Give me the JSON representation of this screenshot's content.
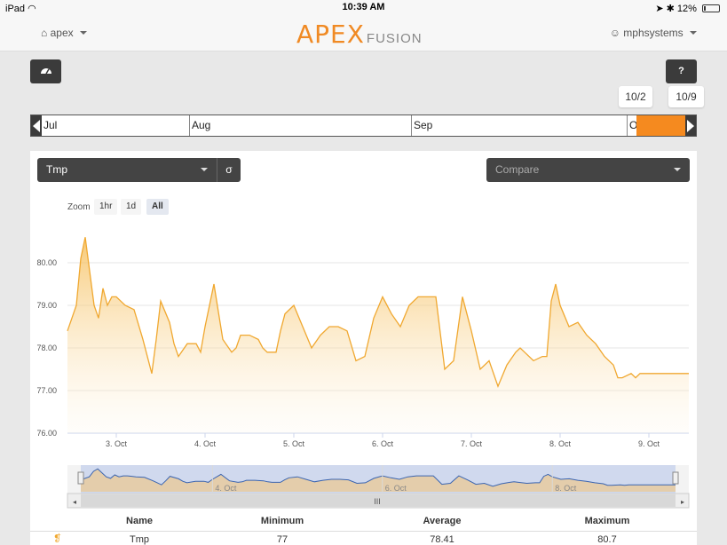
{
  "status_bar": {
    "device": "iPad",
    "time": "10:39 AM",
    "battery": "12%"
  },
  "nav": {
    "location": "apex",
    "logo_main": "APEX",
    "logo_sub": "FUSION",
    "user": "mphsystems"
  },
  "toolbar": {
    "help_label": "?",
    "range_start": "10/2",
    "range_end": "10/9"
  },
  "timeline": {
    "months": [
      "Jul",
      "Aug",
      "Sep",
      "O"
    ]
  },
  "panel": {
    "probe": "Tmp",
    "sigma": "σ",
    "compare_placeholder": "Compare",
    "zoom": {
      "label": "Zoom",
      "options": [
        "1hr",
        "1d",
        "All"
      ],
      "active": "All"
    }
  },
  "chart_data": {
    "type": "area",
    "title": "",
    "xlabel": "",
    "ylabel": "",
    "ylim": [
      76,
      81
    ],
    "yticks": [
      "76.00",
      "77.00",
      "78.00",
      "79.00",
      "80.00"
    ],
    "xticks": [
      "3. Oct",
      "4. Oct",
      "5. Oct",
      "6. Oct",
      "7. Oct",
      "8. Oct",
      "9. Oct"
    ],
    "navigator_ticks": [
      "4. Oct",
      "6. Oct",
      "8. Oct"
    ],
    "grid": true,
    "legend": "none",
    "color": "#f5b84a",
    "series": [
      {
        "x": [
          2.45,
          2.55,
          2.6,
          2.65,
          2.7,
          2.75,
          2.8,
          2.85,
          2.9,
          2.95,
          3.0,
          3.05,
          3.1,
          3.2,
          3.3,
          3.4,
          3.45,
          3.5,
          3.6,
          3.65,
          3.7,
          3.8,
          3.9,
          3.95,
          4.0,
          4.1,
          4.2,
          4.3,
          4.35,
          4.4,
          4.45,
          4.5,
          4.6,
          4.65,
          4.7,
          4.8,
          4.85,
          4.9,
          5.0,
          5.1,
          5.2,
          5.3,
          5.4,
          5.5,
          5.6,
          5.7,
          5.8,
          5.9,
          6.0,
          6.1,
          6.2,
          6.3,
          6.4,
          6.5,
          6.6,
          6.7,
          6.8,
          6.9,
          7.0,
          7.1,
          7.2,
          7.3,
          7.4,
          7.5,
          7.55,
          7.6,
          7.7,
          7.8,
          7.85,
          7.9,
          7.95,
          8.0,
          8.1,
          8.2,
          8.3,
          8.4,
          8.5,
          8.6,
          8.65,
          8.7,
          8.8,
          8.85,
          8.9,
          9.0,
          9.1,
          9.2,
          9.3,
          9.4,
          9.45
        ],
        "y": [
          78.4,
          79.0,
          80.1,
          80.6,
          79.8,
          79.0,
          78.7,
          79.4,
          79.0,
          79.2,
          79.2,
          79.1,
          79.0,
          78.9,
          78.2,
          77.4,
          78.2,
          79.1,
          78.6,
          78.1,
          77.8,
          78.1,
          78.1,
          77.9,
          78.5,
          79.5,
          78.2,
          77.9,
          78.0,
          78.3,
          78.3,
          78.3,
          78.2,
          78.0,
          77.9,
          77.9,
          78.4,
          78.8,
          79.0,
          78.5,
          78.0,
          78.3,
          78.5,
          78.5,
          78.4,
          77.7,
          77.8,
          78.7,
          79.2,
          78.8,
          78.5,
          79.0,
          79.2,
          79.2,
          79.2,
          77.5,
          77.7,
          79.2,
          78.4,
          77.5,
          77.7,
          77.1,
          77.6,
          77.9,
          78.0,
          77.9,
          77.7,
          77.8,
          77.8,
          79.1,
          79.5,
          79.0,
          78.5,
          78.6,
          78.3,
          78.1,
          77.8,
          77.6,
          77.3,
          77.3,
          77.4,
          77.3,
          77.4,
          77.4,
          77.4,
          77.4,
          77.4,
          77.4,
          77.4
        ]
      }
    ]
  },
  "table": {
    "headers": [
      "Name",
      "Minimum",
      "Average",
      "Maximum"
    ],
    "rows": [
      {
        "name": "Tmp",
        "min": "77",
        "avg": "78.41",
        "max": "80.7"
      }
    ]
  }
}
